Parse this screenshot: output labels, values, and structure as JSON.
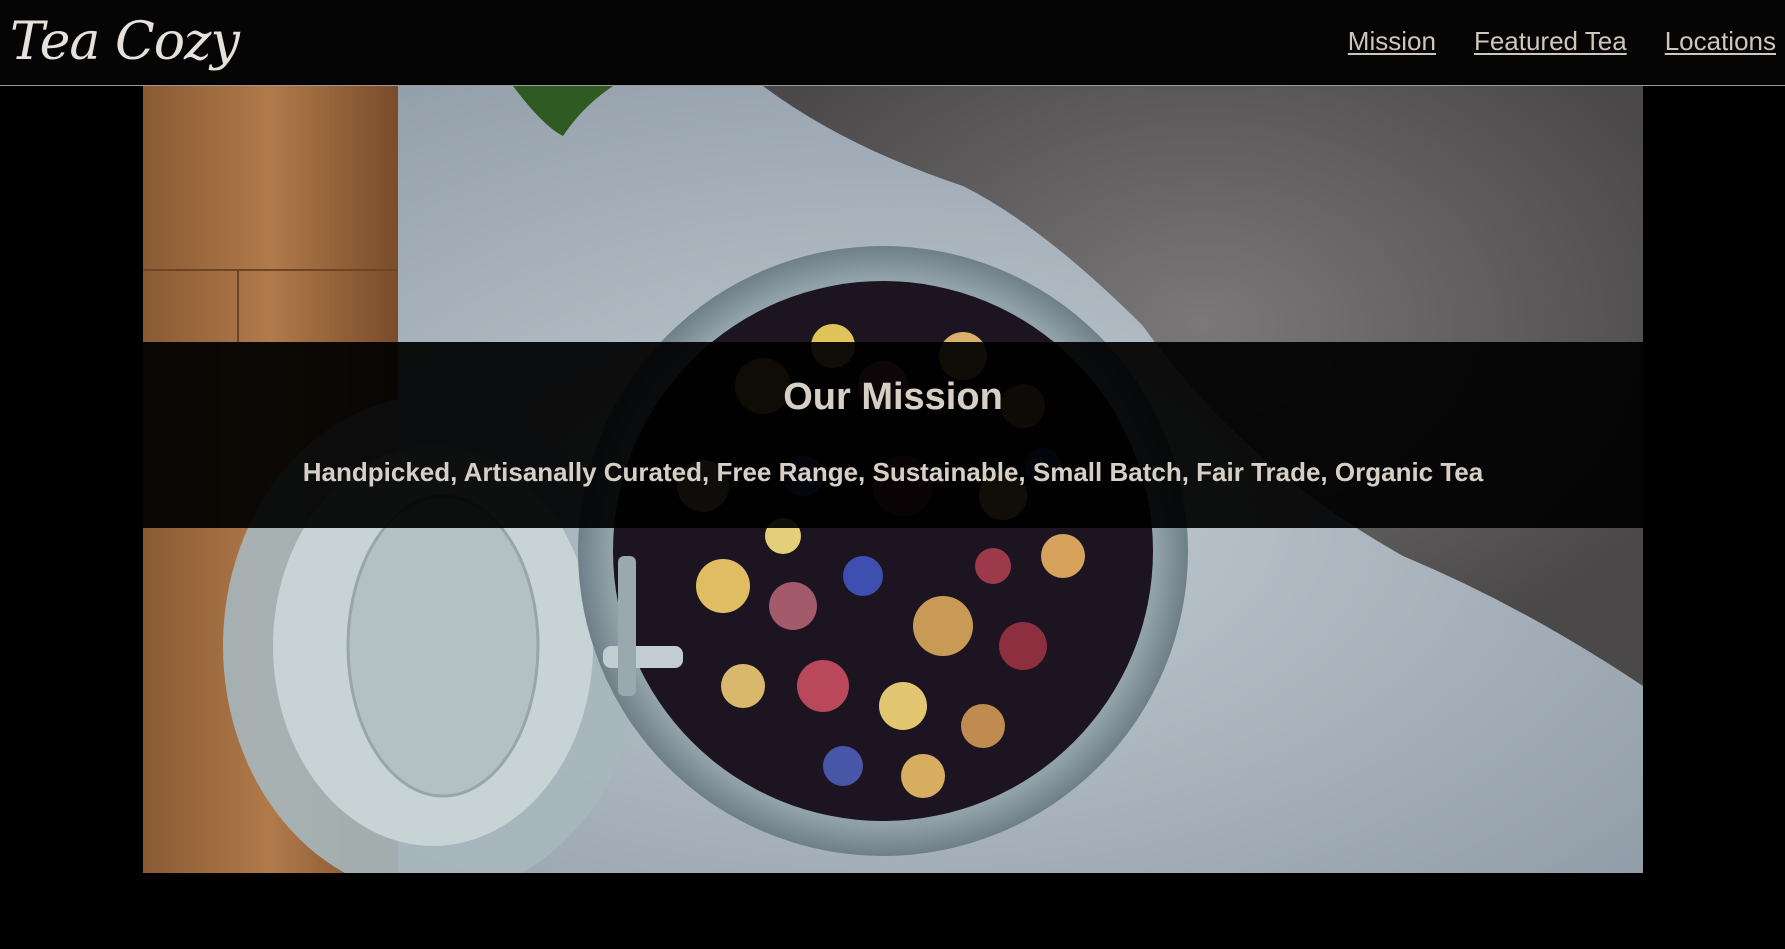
{
  "header": {
    "logo_text": "Tea Cozy",
    "nav": [
      {
        "label": "Mission"
      },
      {
        "label": "Featured Tea"
      },
      {
        "label": "Locations"
      }
    ]
  },
  "hero": {
    "image_subject": "open glass jar of loose-leaf flower tea on a table",
    "mission_title": "Our Mission",
    "mission_tagline": "Handpicked, Artisanally Curated, Free Range, Sustainable, Small Batch, Fair Trade, Organic Tea"
  },
  "colors": {
    "background": "#000000",
    "header_bg": "#050505",
    "text": "#d6cfc6",
    "overlay": "rgba(0,0,0,0.93)"
  }
}
